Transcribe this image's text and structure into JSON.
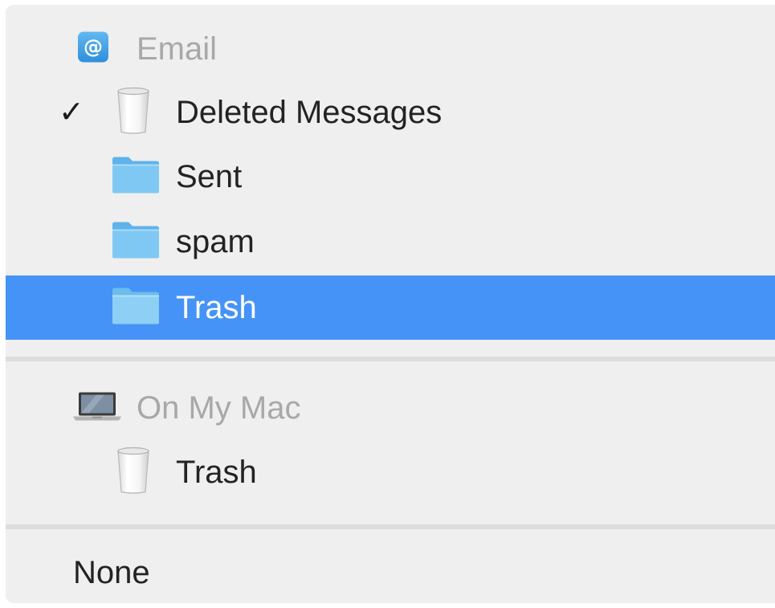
{
  "menu": {
    "accounts": [
      {
        "name": "Email",
        "icon": "at-sign-icon",
        "folders": [
          {
            "label": "Deleted Messages",
            "icon": "trash-can-icon",
            "checked": true,
            "selected": false
          },
          {
            "label": "Sent",
            "icon": "folder-icon",
            "checked": false,
            "selected": false
          },
          {
            "label": "spam",
            "icon": "folder-icon",
            "checked": false,
            "selected": false
          },
          {
            "label": "Trash",
            "icon": "folder-icon",
            "checked": false,
            "selected": true
          }
        ]
      },
      {
        "name": "On My Mac",
        "icon": "laptop-icon",
        "folders": [
          {
            "label": "Trash",
            "icon": "trash-can-icon",
            "checked": false,
            "selected": false
          }
        ]
      }
    ],
    "none_label": "None",
    "checkmark": "✓"
  },
  "colors": {
    "background": "#efefef",
    "selection": "#4593f6",
    "header_text": "#a8a8a8",
    "item_text": "#232323",
    "folder_blue": "#7cc4f2"
  }
}
